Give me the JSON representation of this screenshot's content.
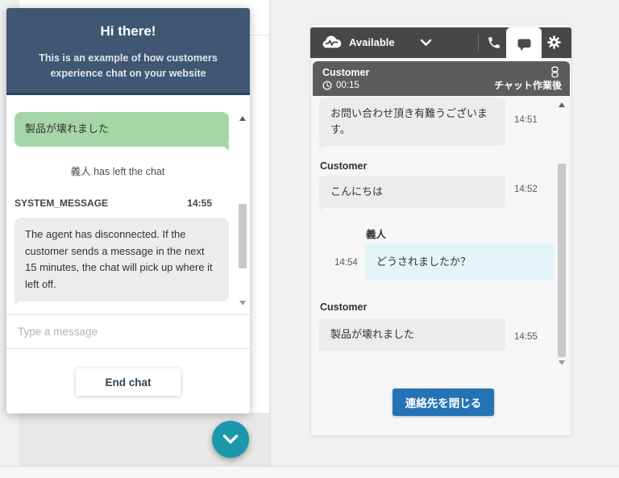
{
  "colors": {
    "widget_header_bg": "#3f5773",
    "customer_bubble_green": "#a5d6a7",
    "system_bubble_gray": "#ececec",
    "agent_bubble_cyan": "#e2f4f6",
    "ccp_bar_bg": "#474747",
    "contact_tab_bg": "#5d5b5b",
    "close_button_blue": "#2373b5",
    "scroll_fab_teal": "#1b97ab"
  },
  "customer_widget": {
    "header": {
      "title": "Hi there!",
      "subtitle_line1": "This is an example of how customers",
      "subtitle_line2": "experience chat on your website"
    },
    "messages": {
      "customer_message": "製品が壊れました",
      "event_text": "義人 has left the chat",
      "system_label": "SYSTEM_MESSAGE",
      "system_time": "14:55",
      "system_body": "The agent has disconnected. If the customer sends a message in the next 15 minutes, the chat will pick up where it left off."
    },
    "input_placeholder": "Type a message",
    "end_chat_label": "End chat"
  },
  "ccp": {
    "status_label": "Available",
    "contact": {
      "name": "Customer",
      "timer": "00:15",
      "state_label": "チャット作業後"
    },
    "chat": {
      "labels": {
        "customer": "Customer",
        "agent": "義人"
      },
      "messages": [
        {
          "text": "お問い合わせ頂き有難うございます。",
          "time": "14:51"
        },
        {
          "text": "こんにちは",
          "time": "14:52"
        },
        {
          "text": "どうされましたか？",
          "time": "14:54"
        },
        {
          "text": "製品が壊れました",
          "time": "14:55"
        }
      ]
    },
    "close_contact_label": "連絡先を閉じる"
  }
}
